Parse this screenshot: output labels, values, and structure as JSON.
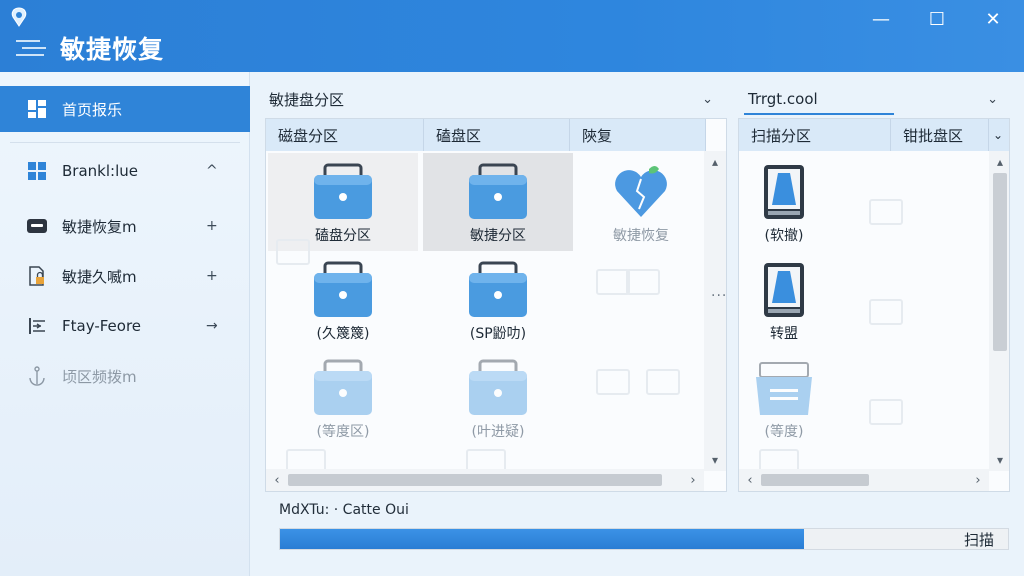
{
  "app": {
    "title": "敏捷恢复",
    "window_controls": {
      "minimize": "—",
      "maximize": "☐",
      "close": "✕"
    }
  },
  "sidebar": {
    "items": [
      {
        "label": "首页报乐",
        "icon": "dashboard-icon",
        "arrow": "",
        "state": "active"
      },
      {
        "label": "Brankl:lue",
        "icon": "grid-icon",
        "arrow": "^",
        "state": "normal"
      },
      {
        "label": "敏捷恢复m",
        "icon": "drive-icon",
        "arrow": "+",
        "state": "normal"
      },
      {
        "label": "敏捷久喴m",
        "icon": "document-lock-icon",
        "arrow": "+",
        "state": "normal"
      },
      {
        "label": "Ftay-Feore",
        "icon": "list-arrow-icon",
        "arrow": "→",
        "state": "normal"
      },
      {
        "label": "顷区频拨m",
        "icon": "anchor-icon",
        "arrow": "",
        "state": "disabled"
      }
    ]
  },
  "left_panel": {
    "dropdown_label": "敏捷盘分区",
    "dropdown_icon": "chevron-down-icon",
    "columns": [
      "磁盘分区",
      "磕盘区",
      "陝复"
    ],
    "tiles": [
      {
        "label": "磕盘分区",
        "icon": "partition-drive-icon",
        "state": "sel-light"
      },
      {
        "label": "敏捷分区",
        "icon": "partition-drive-icon",
        "state": "sel"
      },
      {
        "label": "敏捷恢复",
        "icon": "broken-heart-icon",
        "state": "faded"
      },
      {
        "label": "(久篾篾)",
        "icon": "partition-drive-icon",
        "state": "normal"
      },
      {
        "label": "(SP鼢叻)",
        "icon": "partition-drive-icon",
        "state": "normal"
      },
      {
        "label": "(等度区)",
        "icon": "partition-drive-icon",
        "state": "faded"
      },
      {
        "label": "(叶进疑)",
        "icon": "partition-drive-icon",
        "state": "faded"
      }
    ]
  },
  "right_panel": {
    "dropdown_label": "Trrgt.cool",
    "dropdown_icon": "chevron-down-icon",
    "columns": [
      "扫描分区",
      "钳批盘区"
    ],
    "tiles": [
      {
        "label": "(软撤)",
        "icon": "disk-drive-icon",
        "state": "normal"
      },
      {
        "label": "转盟",
        "icon": "disk-drive-icon",
        "state": "normal"
      },
      {
        "label": "(等度)",
        "icon": "tray-drive-icon",
        "state": "faded"
      }
    ]
  },
  "status": {
    "text": "MdXTu: · Catte Oui",
    "progress": 0.72,
    "scan_button": "扫描"
  },
  "colors": {
    "accent": "#2f84d8",
    "titlebar": "#2e86de",
    "drive_blue": "#4a9be0"
  }
}
